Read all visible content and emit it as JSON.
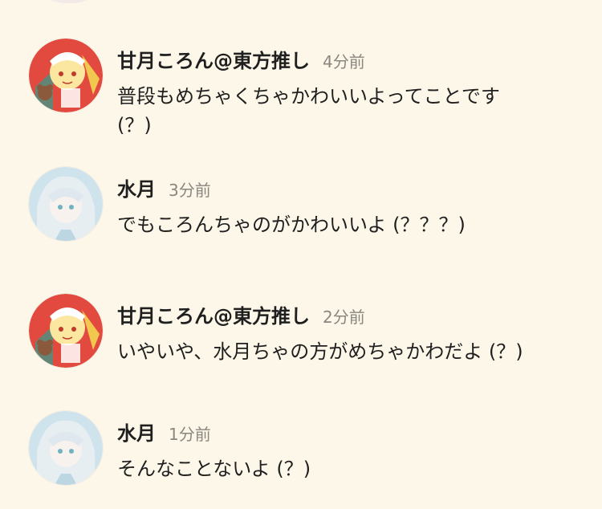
{
  "messages": [
    {
      "user": "甘月ころん@東方推し",
      "time": "4分前",
      "text": "普段もめちゃくちゃかわいいよってことです\n(？)",
      "avatar": "flandre-avatar"
    },
    {
      "user": "水月",
      "time": "3分前",
      "text": "でもころんちゃのがかわいいよ (？？？)",
      "avatar": "silver-hair-girl-avatar"
    },
    {
      "user": "甘月ころん@東方推し",
      "time": "2分前",
      "text": "いやいや、水月ちゃの方がめちゃかわだよ (？)",
      "avatar": "flandre-avatar"
    },
    {
      "user": "水月",
      "time": "1分前",
      "text": "そんなことないよ (？)",
      "avatar": "silver-hair-girl-avatar"
    }
  ],
  "colors": {
    "background": "#fdf7e9",
    "name": "#1f1f1f",
    "timestamp": "#8a8680",
    "avatar_red": "#e24a3f",
    "avatar_blue": "#cfe3ec"
  }
}
